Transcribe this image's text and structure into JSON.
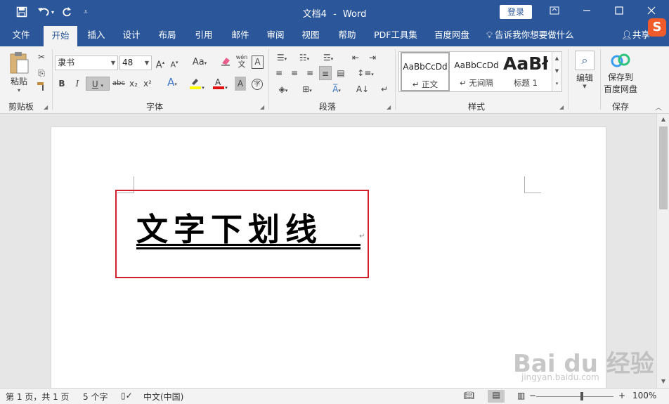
{
  "window": {
    "doc_name": "文档4",
    "app_name": "Word",
    "separator": "-",
    "login_label": "登录"
  },
  "quick_access": {
    "save_icon": "save-icon",
    "undo_icon": "undo-icon",
    "redo_icon": "redo-icon",
    "customize_icon": "customize-icon"
  },
  "tabs": [
    "文件",
    "开始",
    "插入",
    "设计",
    "布局",
    "引用",
    "邮件",
    "审阅",
    "视图",
    "帮助",
    "PDF工具集",
    "百度网盘"
  ],
  "active_tab": "开始",
  "tell_me": "告诉我你想要做什么",
  "share_label": "共享",
  "sogou_label": "S",
  "ribbon": {
    "clipboard": {
      "paste_label": "粘贴",
      "group_label": "剪贴板"
    },
    "font": {
      "font_name": "隶书",
      "font_size": "48",
      "group_label": "字体",
      "bold": "B",
      "italic": "I",
      "underline": "U",
      "strike": "abc",
      "subscript": "x₂",
      "superscript": "x²",
      "grow": "A",
      "shrink": "A",
      "case": "Aa",
      "pinyin": "wén",
      "pinyin_char": "文",
      "border_char": "A",
      "enclose_char": "字"
    },
    "paragraph": {
      "group_label": "段落"
    },
    "styles": {
      "group_label": "样式",
      "items": [
        {
          "sample": "AaBbCcDd",
          "name": "正文"
        },
        {
          "sample": "AaBbCcDd",
          "name": "无间隔"
        },
        {
          "sample": "AaBł",
          "name": "标题 1"
        }
      ]
    },
    "editing": {
      "label": "编辑"
    },
    "save": {
      "label_line1": "保存到",
      "label_line2": "百度网盘",
      "group_label": "保存"
    }
  },
  "document": {
    "text": "文字下划线"
  },
  "status": {
    "page": "第 1 页，共 1 页",
    "words": "5 个字",
    "language": "中文(中国)",
    "zoom": "100%",
    "zoom_minus": "−",
    "zoom_plus": "+"
  },
  "watermark": {
    "text": "Bai du 经验",
    "sub": "jingyan.baidu.com"
  },
  "colors": {
    "brand": "#2b579a",
    "highlight_border": "#d0202b",
    "font_color_bar": "#e01010",
    "highlight_bar": "#ffff00"
  }
}
